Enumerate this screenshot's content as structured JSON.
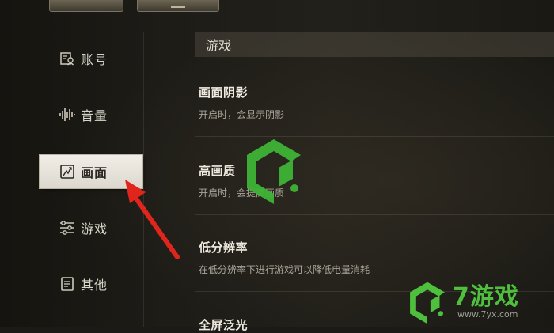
{
  "sidebar": {
    "items": [
      {
        "label": "账号",
        "icon": "account-icon"
      },
      {
        "label": "音量",
        "icon": "volume-icon"
      },
      {
        "label": "画面",
        "icon": "display-icon",
        "active": true
      },
      {
        "label": "游戏",
        "icon": "sliders-icon"
      },
      {
        "label": "其他",
        "icon": "document-icon"
      }
    ]
  },
  "content": {
    "section_title": "游戏",
    "settings": [
      {
        "title": "画面阴影",
        "desc": "开启时，会显示阴影"
      },
      {
        "title": "高画质",
        "desc": "开启时，会提高画质"
      },
      {
        "title": "低分辨率",
        "desc": "在低分辨率下进行游戏可以降低电量消耗"
      },
      {
        "title": "全屏泛光",
        "desc": ""
      }
    ]
  },
  "watermark": {
    "brand": "7游戏",
    "url": "www.7yx.com"
  },
  "colors": {
    "accent_green": "#4fbf3e",
    "arrow_red": "#e0251d",
    "active_tab_bg": "#eeebe4"
  }
}
